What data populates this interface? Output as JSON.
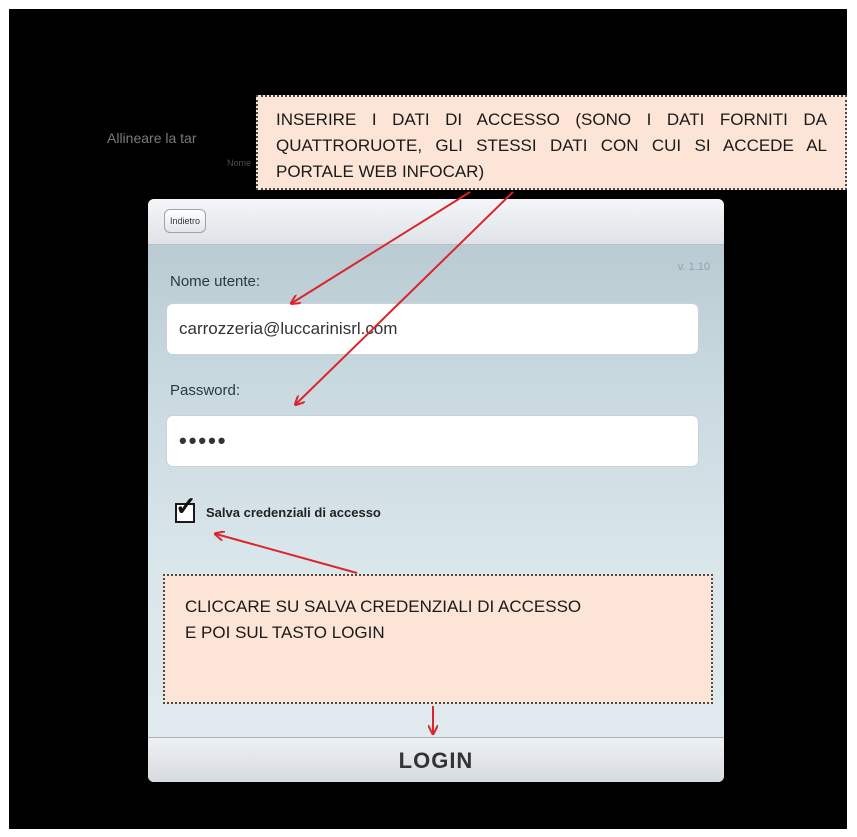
{
  "background": {
    "instruction_text": "Allineare la tar",
    "subtext": "Nome"
  },
  "app": {
    "back_label": "Indietro",
    "version": "v. 1.10",
    "username_label": "Nome utente:",
    "username_value": "carrozzeria@luccarinisrl.com",
    "password_label": "Password:",
    "password_value": "•••••",
    "save_credentials_label": "Salva credenziali di accesso",
    "save_credentials_checked": true,
    "login_label": "LOGIN"
  },
  "annotations": {
    "top_note": "INSERIRE I DATI DI ACCESSO (SONO I DATI FORNITI DA QUATTRORUOTE, GLI STESSI DATI CON CUI SI ACCEDE AL PORTALE WEB INFOCAR)",
    "bottom_note_line1": "CLICCARE SU SALVA CREDENZIALI DI ACCESSO",
    "bottom_note_line2": "E POI SUL TASTO LOGIN",
    "arrow_color": "#d9252b"
  }
}
